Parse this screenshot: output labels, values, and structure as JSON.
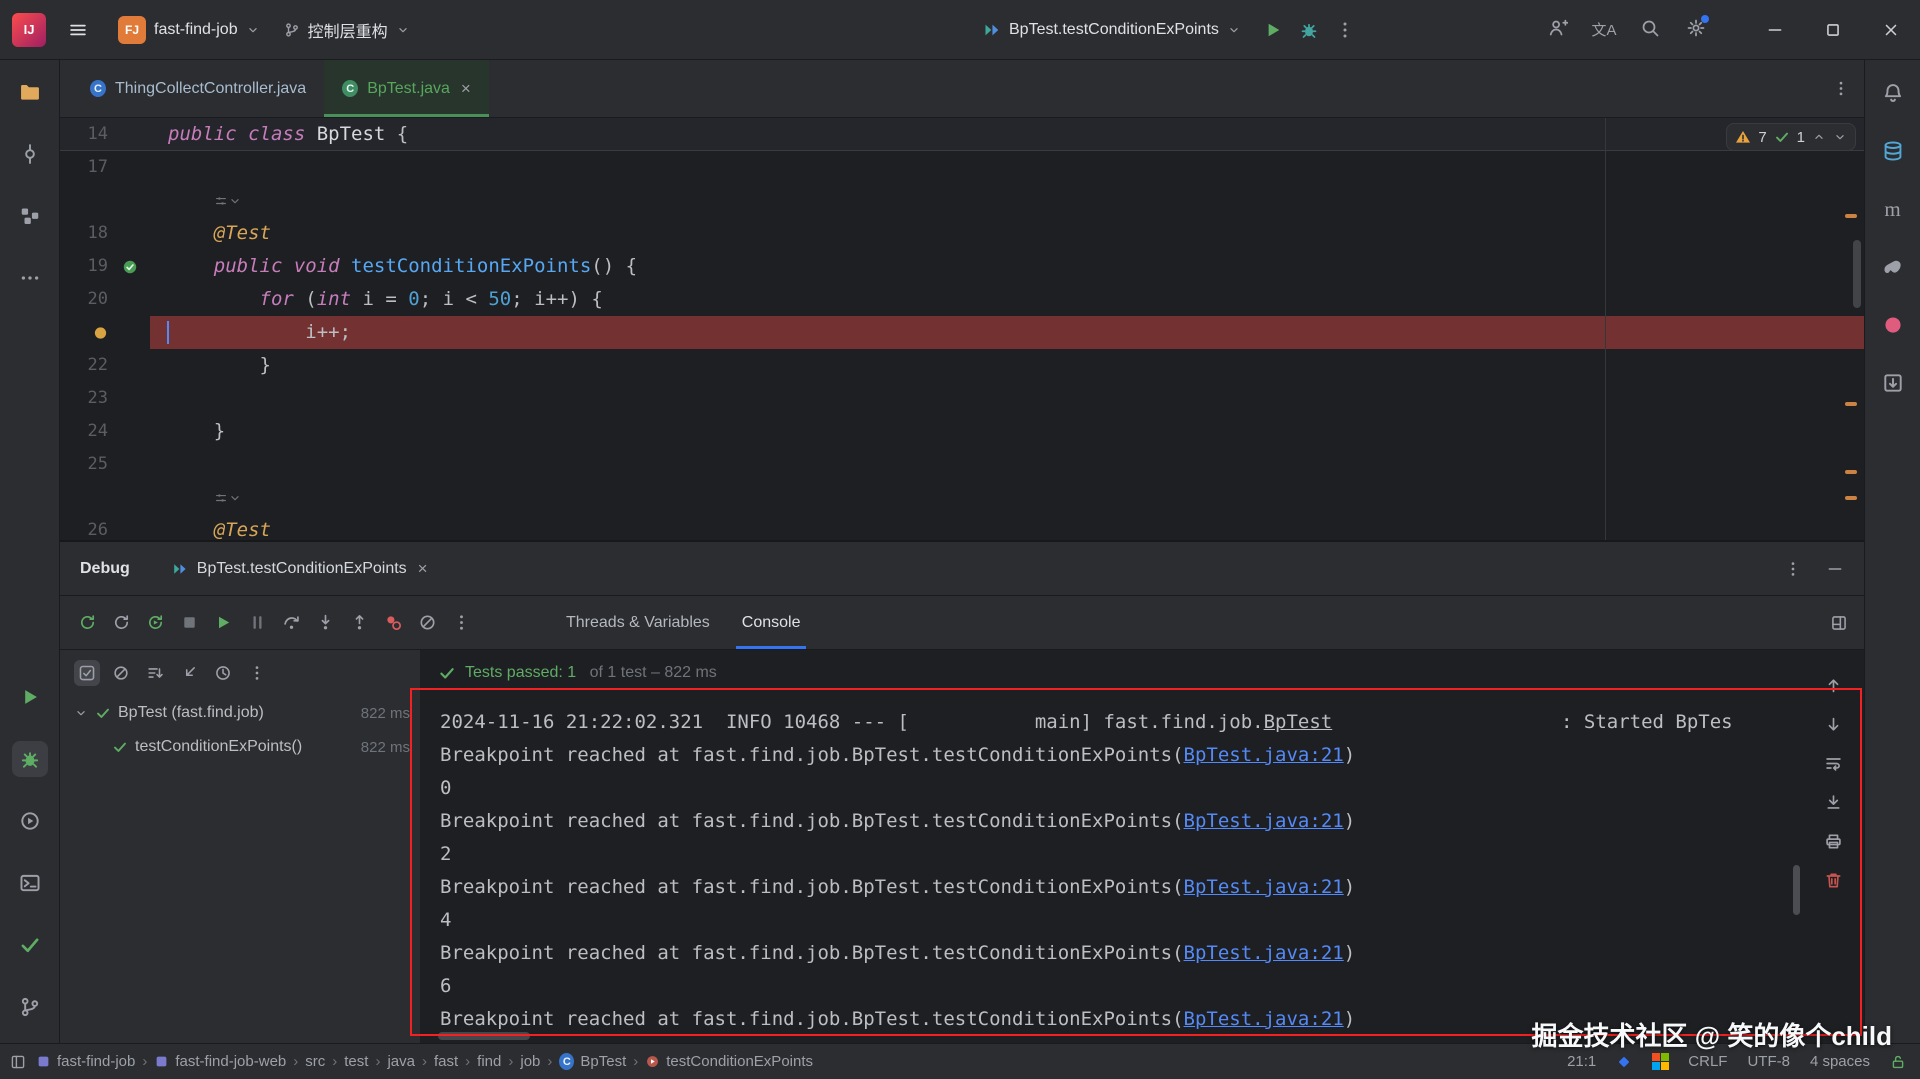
{
  "colors": {
    "accent_blue": "#3574F0",
    "test_green": "#4A9159",
    "exec_line_red": "#733231",
    "link_blue": "#548AF7",
    "warning_orange": "#E8A33D",
    "annotation_red": "#F32121",
    "breakpoint_yellow": "#D9A343"
  },
  "titlebar": {
    "logo_text": "IJ",
    "project": {
      "avatar": "FJ",
      "name": "fast-find-job"
    },
    "branch": "控制层重构",
    "run_config": "BpTest.testConditionExPoints",
    "actions": [
      {
        "name": "run-icon",
        "color": "green"
      },
      {
        "name": "debug-icon",
        "color": "teal"
      },
      {
        "name": "more-vertical-icon",
        "color": "gray"
      }
    ],
    "right_icons": [
      {
        "name": "share-user-icon",
        "color": "gray"
      },
      {
        "name": "translate-icon",
        "color": "gray"
      },
      {
        "name": "search-icon",
        "color": "gray"
      },
      {
        "name": "settings-icon",
        "color": "gray",
        "badge": true
      }
    ],
    "window_controls": [
      {
        "name": "minimize-icon"
      },
      {
        "name": "maximize-icon"
      },
      {
        "name": "close-icon"
      }
    ]
  },
  "editor_tabs": {
    "tabs": [
      {
        "label": "ThingCollectController.java",
        "icon": "class-icon",
        "active": false,
        "close": ""
      },
      {
        "label": "BpTest.java",
        "icon": "test-class-icon",
        "active": true,
        "close": "×"
      }
    ]
  },
  "inspections": {
    "warnings": "7",
    "ok": "1"
  },
  "editor": {
    "lines": [
      {
        "num": "14",
        "sticky": true,
        "segs": [
          {
            "t": "public class ",
            "c": "kw"
          },
          {
            "t": "BpTest ",
            "c": "cls"
          },
          {
            "t": "{",
            "c": "pl"
          }
        ]
      },
      {
        "num": "17",
        "segs": []
      },
      {
        "num": "",
        "inlay": true,
        "segs": []
      },
      {
        "num": "18",
        "segs": [
          {
            "t": "    @Test",
            "c": "ann"
          }
        ]
      },
      {
        "num": "19",
        "gutter": "test-passed",
        "segs": [
          {
            "t": "    ",
            "c": "pl"
          },
          {
            "t": "public void ",
            "c": "kw"
          },
          {
            "t": "testConditionExPoints",
            "c": "method"
          },
          {
            "t": "() {",
            "c": "pl"
          }
        ]
      },
      {
        "num": "20",
        "segs": [
          {
            "t": "        ",
            "c": "pl"
          },
          {
            "t": "for ",
            "c": "kw"
          },
          {
            "t": "(",
            "c": "pl"
          },
          {
            "t": "int ",
            "c": "kw"
          },
          {
            "t": "i = ",
            "c": "pl"
          },
          {
            "t": "0",
            "c": "num"
          },
          {
            "t": "; i < ",
            "c": "pl"
          },
          {
            "t": "50",
            "c": "num"
          },
          {
            "t": "; i++) {",
            "c": "pl"
          }
        ]
      },
      {
        "num": "",
        "gutter": "breakpoint",
        "highlight": true,
        "segs": [
          {
            "t": "            i++;",
            "c": "pl"
          }
        ]
      },
      {
        "num": "22",
        "segs": [
          {
            "t": "        }",
            "c": "pl"
          }
        ]
      },
      {
        "num": "23",
        "segs": []
      },
      {
        "num": "24",
        "segs": [
          {
            "t": "    }",
            "c": "pl"
          }
        ]
      },
      {
        "num": "25",
        "segs": []
      },
      {
        "num": "",
        "inlay": true,
        "segs": []
      },
      {
        "num": "26",
        "segs": [
          {
            "t": "    @Test",
            "c": "ann"
          }
        ]
      }
    ]
  },
  "debug": {
    "title": "Debug",
    "tab": {
      "icon": "run-config-icon",
      "label": "BpTest.testConditionExPoints",
      "close": "×"
    },
    "toolbar_icons": [
      {
        "name": "rerun-icon",
        "color": "green"
      },
      {
        "name": "rerun-failed-icon",
        "color": "gray"
      },
      {
        "name": "refresh-run-icon",
        "color": "green"
      },
      {
        "name": "stop-icon",
        "color": "dim"
      },
      {
        "name": "resume-icon",
        "color": "green"
      },
      {
        "name": "pause-icon",
        "color": "dim"
      },
      {
        "name": "step-over-icon",
        "color": "gray"
      },
      {
        "name": "step-into-icon",
        "color": "gray"
      },
      {
        "name": "step-out-icon",
        "color": "gray"
      },
      {
        "name": "view-breakpoints-icon",
        "color": "red"
      },
      {
        "name": "mute-breakpoints-icon",
        "color": "gray"
      },
      {
        "name": "more-vertical-icon",
        "color": "gray"
      }
    ],
    "view_tabs": [
      {
        "label": "Threads & Variables",
        "active": false
      },
      {
        "label": "Console",
        "active": true
      }
    ],
    "runner_icons": [
      {
        "name": "show-passed-icon",
        "color": "gray",
        "selected": true
      },
      {
        "name": "show-ignored-icon",
        "color": "gray"
      },
      {
        "name": "sort-icon",
        "color": "gray"
      },
      {
        "name": "navigate-icon",
        "color": "gray"
      },
      {
        "name": "duration-icon",
        "color": "gray"
      },
      {
        "name": "more-vertical-icon",
        "color": "gray"
      }
    ],
    "tree": [
      {
        "label": "BpTest (fast.find.job)",
        "time": "822 ms",
        "level": 0,
        "expanded": true
      },
      {
        "label": "testConditionExPoints()",
        "time": "822 ms",
        "level": 1
      }
    ],
    "summary": {
      "passed": "Tests passed: 1",
      "rest": " of 1 test – 822 ms"
    },
    "console_lines": [
      {
        "segs": [
          {
            "t": "2024-11-16 21:22:02.321  INFO 10468 --- [           main] fast.find.job.",
            "c": "pl"
          },
          {
            "t": "BpTest",
            "c": "soft"
          },
          {
            "t": "                    : Started BpTes",
            "c": "pl"
          }
        ]
      },
      {
        "segs": [
          {
            "t": "Breakpoint reached at fast.find.job.BpTest.testConditionExPoints(",
            "c": "pl"
          },
          {
            "t": "BpTest.java:21",
            "c": "link"
          },
          {
            "t": ")",
            "c": "pl"
          }
        ]
      },
      {
        "segs": [
          {
            "t": "0",
            "c": "pl"
          }
        ]
      },
      {
        "segs": [
          {
            "t": "Breakpoint reached at fast.find.job.BpTest.testConditionExPoints(",
            "c": "pl"
          },
          {
            "t": "BpTest.java:21",
            "c": "link"
          },
          {
            "t": ")",
            "c": "pl"
          }
        ]
      },
      {
        "segs": [
          {
            "t": "2",
            "c": "pl"
          }
        ]
      },
      {
        "segs": [
          {
            "t": "Breakpoint reached at fast.find.job.BpTest.testConditionExPoints(",
            "c": "pl"
          },
          {
            "t": "BpTest.java:21",
            "c": "link"
          },
          {
            "t": ")",
            "c": "pl"
          }
        ]
      },
      {
        "segs": [
          {
            "t": "4",
            "c": "pl"
          }
        ]
      },
      {
        "segs": [
          {
            "t": "Breakpoint reached at fast.find.job.BpTest.testConditionExPoints(",
            "c": "pl"
          },
          {
            "t": "BpTest.java:21",
            "c": "link"
          },
          {
            "t": ")",
            "c": "pl"
          }
        ]
      },
      {
        "segs": [
          {
            "t": "6",
            "c": "pl"
          }
        ]
      },
      {
        "segs": [
          {
            "t": "Breakpoint reached at fast.find.job.BpTest.testConditionExPoints(",
            "c": "pl"
          },
          {
            "t": "BpTest.java:21",
            "c": "link"
          },
          {
            "t": ")",
            "c": "pl"
          }
        ]
      }
    ],
    "console_side_icons": [
      {
        "name": "scroll-up-icon",
        "color": "gray"
      },
      {
        "name": "scroll-down-icon",
        "color": "gray"
      },
      {
        "name": "soft-wrap-icon",
        "color": "gray"
      },
      {
        "name": "scroll-to-end-icon",
        "color": "gray"
      },
      {
        "name": "print-icon",
        "color": "gray"
      },
      {
        "name": "clear-icon",
        "color": "red-dim"
      }
    ]
  },
  "left_bar": {
    "top": [
      {
        "name": "project-icon",
        "color": "folder"
      },
      {
        "name": "commit-icon",
        "color": "gray"
      },
      {
        "name": "structure-icon",
        "color": "gray"
      },
      {
        "name": "more-horizontal-icon",
        "color": "gray"
      }
    ],
    "bottom": [
      {
        "name": "run-icon",
        "color": "green"
      },
      {
        "name": "debug-icon",
        "color": "green",
        "active": true
      },
      {
        "name": "services-icon",
        "color": "gray"
      },
      {
        "name": "terminal-icon",
        "color": "gray"
      },
      {
        "name": "checks-icon",
        "color": "green"
      },
      {
        "name": "git-icon",
        "color": "gray"
      }
    ]
  },
  "right_bar": [
    {
      "name": "notifications-icon",
      "color": "gray"
    },
    {
      "name": "database-icon",
      "color": "db"
    },
    {
      "name": "maven-icon",
      "color": "gray"
    },
    {
      "name": "gradle-icon",
      "color": "gray"
    },
    {
      "name": "plugin-dot-icon",
      "color": "pink"
    },
    {
      "name": "dependencies-icon",
      "color": "gray"
    }
  ],
  "statusbar": {
    "breadcrumbs": [
      {
        "label": "fast-find-job",
        "icon": "module-icon"
      },
      {
        "label": "fast-find-job-web",
        "icon": "module-icon"
      },
      {
        "label": "src"
      },
      {
        "label": "test"
      },
      {
        "label": "java"
      },
      {
        "label": "fast"
      },
      {
        "label": "find"
      },
      {
        "label": "job"
      },
      {
        "label": "BpTest",
        "icon": "class-icon"
      },
      {
        "label": "testConditionExPoints",
        "icon": "test-method-icon"
      }
    ],
    "separator": "›",
    "caret": "21:1",
    "line_ending": "CRLF",
    "encoding": "UTF-8",
    "indent": "4 spaces"
  },
  "watermark": "掘金技术社区 @ 笑的像个child"
}
